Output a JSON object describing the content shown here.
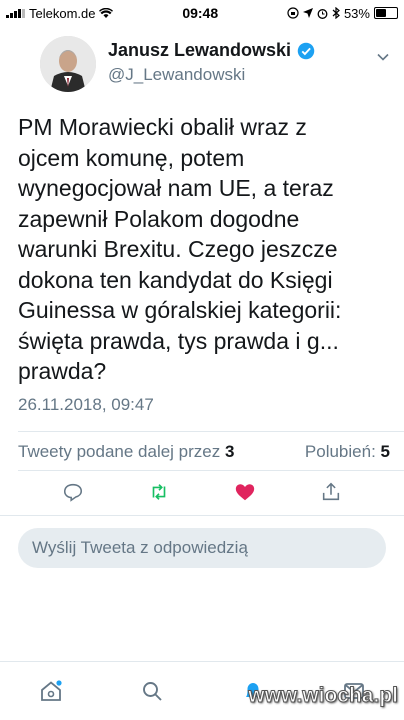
{
  "status_bar": {
    "carrier": "Telekom.de",
    "time": "09:48",
    "battery": "53%",
    "battery_level": 0.53
  },
  "tweet": {
    "display_name": "Janusz Lewandowski",
    "handle": "@J_Lewandowski",
    "text": "PM Morawiecki obalił wraz z\nojcem komunę, potem\nwynegocjował nam UE, a teraz\nzapewnił Polakom dogodne\nwarunki Brexitu. Czego jeszcze\ndokona ten kandydat do Księgi\nGuinessa w góralskiej kategorii:\nświęta prawda, tys prawda i g...\nprawda?",
    "timestamp": "26.11.2018, 09:47",
    "retweets_label": "Tweety podane dalej przez",
    "retweets_count": "3",
    "likes_label": "Polubień:",
    "likes_count": "5"
  },
  "reply": {
    "placeholder": "Wyślij Tweeta z odpowiedzią"
  },
  "watermark": "www.wiocha.pl",
  "colors": {
    "accent": "#1da1f2",
    "like": "#e0245e",
    "retweet": "#17bf63"
  }
}
